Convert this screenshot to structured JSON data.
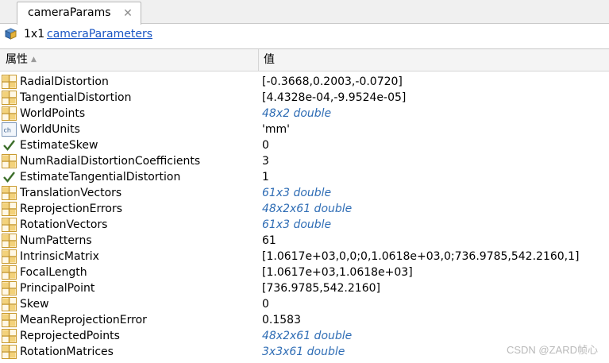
{
  "tab": {
    "title": "cameraParams",
    "close_glyph": "✕"
  },
  "summary": {
    "size": "1x1",
    "class_name": "cameraParameters",
    "icon": "object-icon"
  },
  "table": {
    "headers": {
      "property": "属性",
      "value": "值"
    },
    "rows": [
      {
        "name": "RadialDistortion",
        "value": "[-0.3668,0.2003,-0.0720]",
        "icon": "grid-icon",
        "italic": false
      },
      {
        "name": "TangentialDistortion",
        "value": "[4.4328e-04,-9.9524e-05]",
        "icon": "grid-icon",
        "italic": false
      },
      {
        "name": "WorldPoints",
        "value": "48x2 double",
        "icon": "grid-icon",
        "italic": true
      },
      {
        "name": "WorldUnits",
        "value": "'mm'",
        "icon": "char-icon",
        "italic": false
      },
      {
        "name": "EstimateSkew",
        "value": "0",
        "icon": "checkmark-icon",
        "italic": false
      },
      {
        "name": "NumRadialDistortionCoefficients",
        "value": "3",
        "icon": "grid-icon",
        "italic": false
      },
      {
        "name": "EstimateTangentialDistortion",
        "value": "1",
        "icon": "checkmark-icon",
        "italic": false
      },
      {
        "name": "TranslationVectors",
        "value": "61x3 double",
        "icon": "grid-icon",
        "italic": true
      },
      {
        "name": "ReprojectionErrors",
        "value": "48x2x61 double",
        "icon": "grid-icon",
        "italic": true
      },
      {
        "name": "RotationVectors",
        "value": "61x3 double",
        "icon": "grid-icon",
        "italic": true
      },
      {
        "name": "NumPatterns",
        "value": "61",
        "icon": "grid-icon",
        "italic": false
      },
      {
        "name": "IntrinsicMatrix",
        "value": "[1.0617e+03,0,0;0,1.0618e+03,0;736.9785,542.2160,1]",
        "icon": "grid-icon",
        "italic": false
      },
      {
        "name": "FocalLength",
        "value": "[1.0617e+03,1.0618e+03]",
        "icon": "grid-icon",
        "italic": false
      },
      {
        "name": "PrincipalPoint",
        "value": "[736.9785,542.2160]",
        "icon": "grid-icon",
        "italic": false
      },
      {
        "name": "Skew",
        "value": "0",
        "icon": "grid-icon",
        "italic": false
      },
      {
        "name": "MeanReprojectionError",
        "value": "0.1583",
        "icon": "grid-icon",
        "italic": false
      },
      {
        "name": "ReprojectedPoints",
        "value": "48x2x61 double",
        "icon": "grid-icon",
        "italic": true
      },
      {
        "name": "RotationMatrices",
        "value": "3x3x61 double",
        "icon": "grid-icon",
        "italic": true
      }
    ]
  },
  "watermark": "CSDN @ZARD帧心",
  "colors": {
    "link": "#1a56c4",
    "summary_value": "#2f6db5",
    "grid_icon": "#d9a021"
  }
}
